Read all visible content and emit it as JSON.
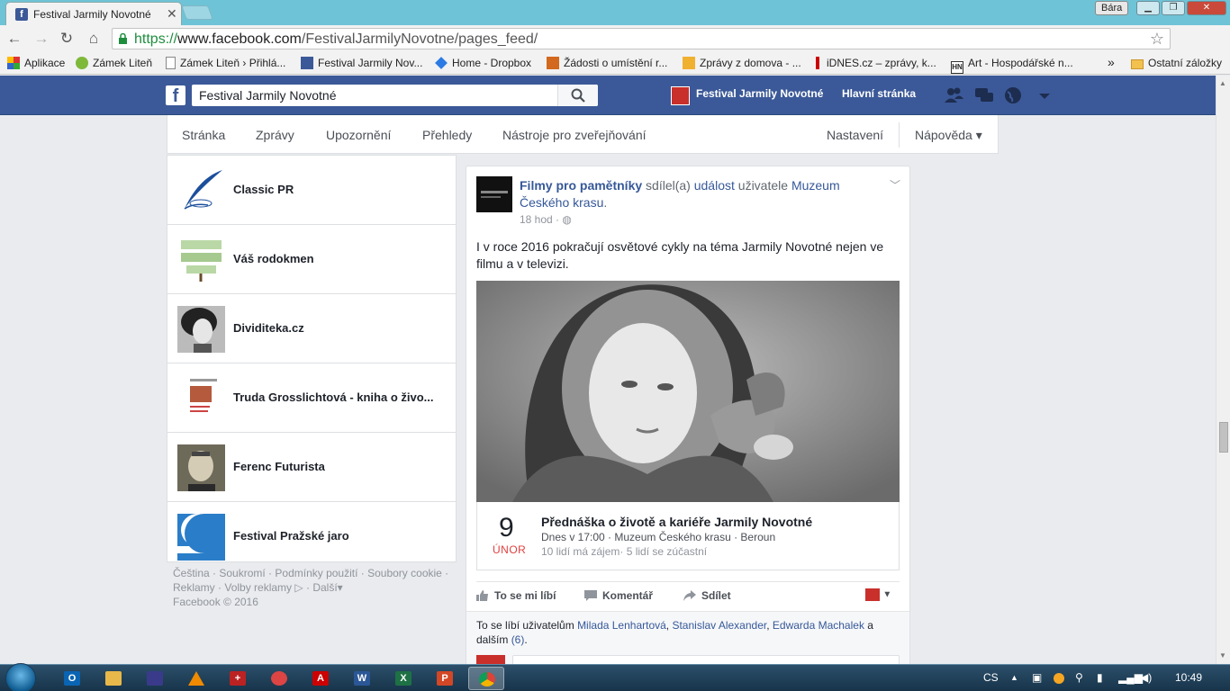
{
  "browser": {
    "tab_title": "Festival Jarmily Novotné",
    "tab_close": "✕",
    "user": "Bára",
    "url_scheme": "https://",
    "url_host": "www.facebook.com",
    "url_path": "/FestivalJarmilyNovotne/pages_feed/",
    "bookmarks": [
      {
        "label": "Aplikace"
      },
      {
        "label": "Zámek Liteň"
      },
      {
        "label": "Zámek Liteň › Přihlá..."
      },
      {
        "label": "Festival Jarmily Nov..."
      },
      {
        "label": "Home - Dropbox"
      },
      {
        "label": "Žádosti o umístění r..."
      },
      {
        "label": "Zprávy z domova - ..."
      },
      {
        "label": "iDNES.cz – zprávy, k..."
      },
      {
        "label": "Art - Hospodářské n..."
      }
    ],
    "bookmarks_more": "»",
    "other_bookmarks": "Ostatní záložky"
  },
  "fb_header": {
    "logo": "f",
    "search_value": "Festival Jarmily Novotné",
    "page_name": "Festival Jarmily Novotné",
    "home_label": "Hlavní stránka"
  },
  "page_nav": {
    "items": [
      "Stránka",
      "Zprávy",
      "Upozornění",
      "Přehledy",
      "Nástroje pro zveřejňování"
    ],
    "settings": "Nastavení",
    "help": "Nápověda ▾"
  },
  "liked_pages": [
    {
      "name": "Classic PR"
    },
    {
      "name": "Váš rodokmen"
    },
    {
      "name": "Dividiteka.cz"
    },
    {
      "name": "Truda Grosslichtová - kniha o živo..."
    },
    {
      "name": "Ferenc Futurista"
    },
    {
      "name": "Festival Pražské jaro"
    }
  ],
  "footer": {
    "links": [
      "Čeština",
      "Soukromí",
      "Podmínky použití",
      "Soubory cookie",
      "Reklamy",
      "Volby reklamy",
      "Další"
    ],
    "copyright": "Facebook © 2016"
  },
  "post": {
    "actor": "Filmy pro pamětníky",
    "verb_shared": "sdílel(a)",
    "object": "událost",
    "verb_of": "uživatele",
    "target": "Muzeum Českého krasu",
    "target_end": ".",
    "time": "18 hod",
    "text": "I v roce 2016 pokračují osvětové cykly na téma Jarmily Novotné nejen ve filmu a v televizi.",
    "event": {
      "day": "9",
      "month": "ÚNOR",
      "title": "Přednáška o životě a kariéře Jarmily Novotné",
      "meta": "Dnes v 17:00 · Muzeum Českého krasu · Beroun",
      "stats": "10 lidí má zájem· 5 lidí se zúčastní"
    },
    "actions": {
      "like": "To se mi líbí",
      "comment": "Komentář",
      "share": "Sdílet"
    },
    "likes": {
      "prefix": "To se líbí uživatelům",
      "names": [
        "Milada Lenhartová",
        "Stanislav Alexander",
        "Edwarda Machalek"
      ],
      "suffix_a": "a",
      "suffix_more": "dalším",
      "more_count": "(6)",
      "end": "."
    }
  },
  "taskbar": {
    "lang": "CS",
    "clock": "10:49"
  },
  "colors": {
    "fb_blue": "#3b5998",
    "link_blue": "#365899",
    "event_red": "#e03f3f",
    "page_bg": "#e9ebee"
  }
}
